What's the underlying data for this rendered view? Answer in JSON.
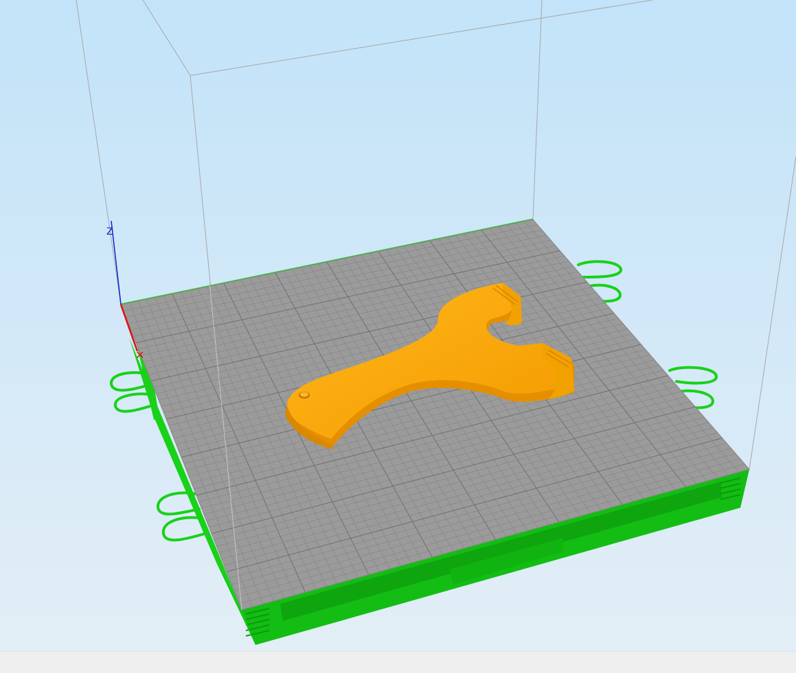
{
  "app": {
    "scene": "3d-print-preview"
  },
  "colors": {
    "sky_top": "#c2e3f9",
    "sky_bottom": "#e3eef6",
    "bed_surface": "#9b9b9b",
    "bed_grid": "#7e7e7e",
    "bed_frame": "#19d119",
    "bed_frame_dark": "#0fa50f",
    "model": "#ffaa00",
    "model_shade": "#e58f00",
    "axis_x": "#e01010",
    "axis_z": "#1020d0",
    "volume_edge": "#a7a7a7"
  },
  "objects": {
    "model_name": "slingshot-model",
    "bed_name": "print-bed",
    "volume_name": "build-volume"
  },
  "statusbar": {
    "text": ""
  }
}
